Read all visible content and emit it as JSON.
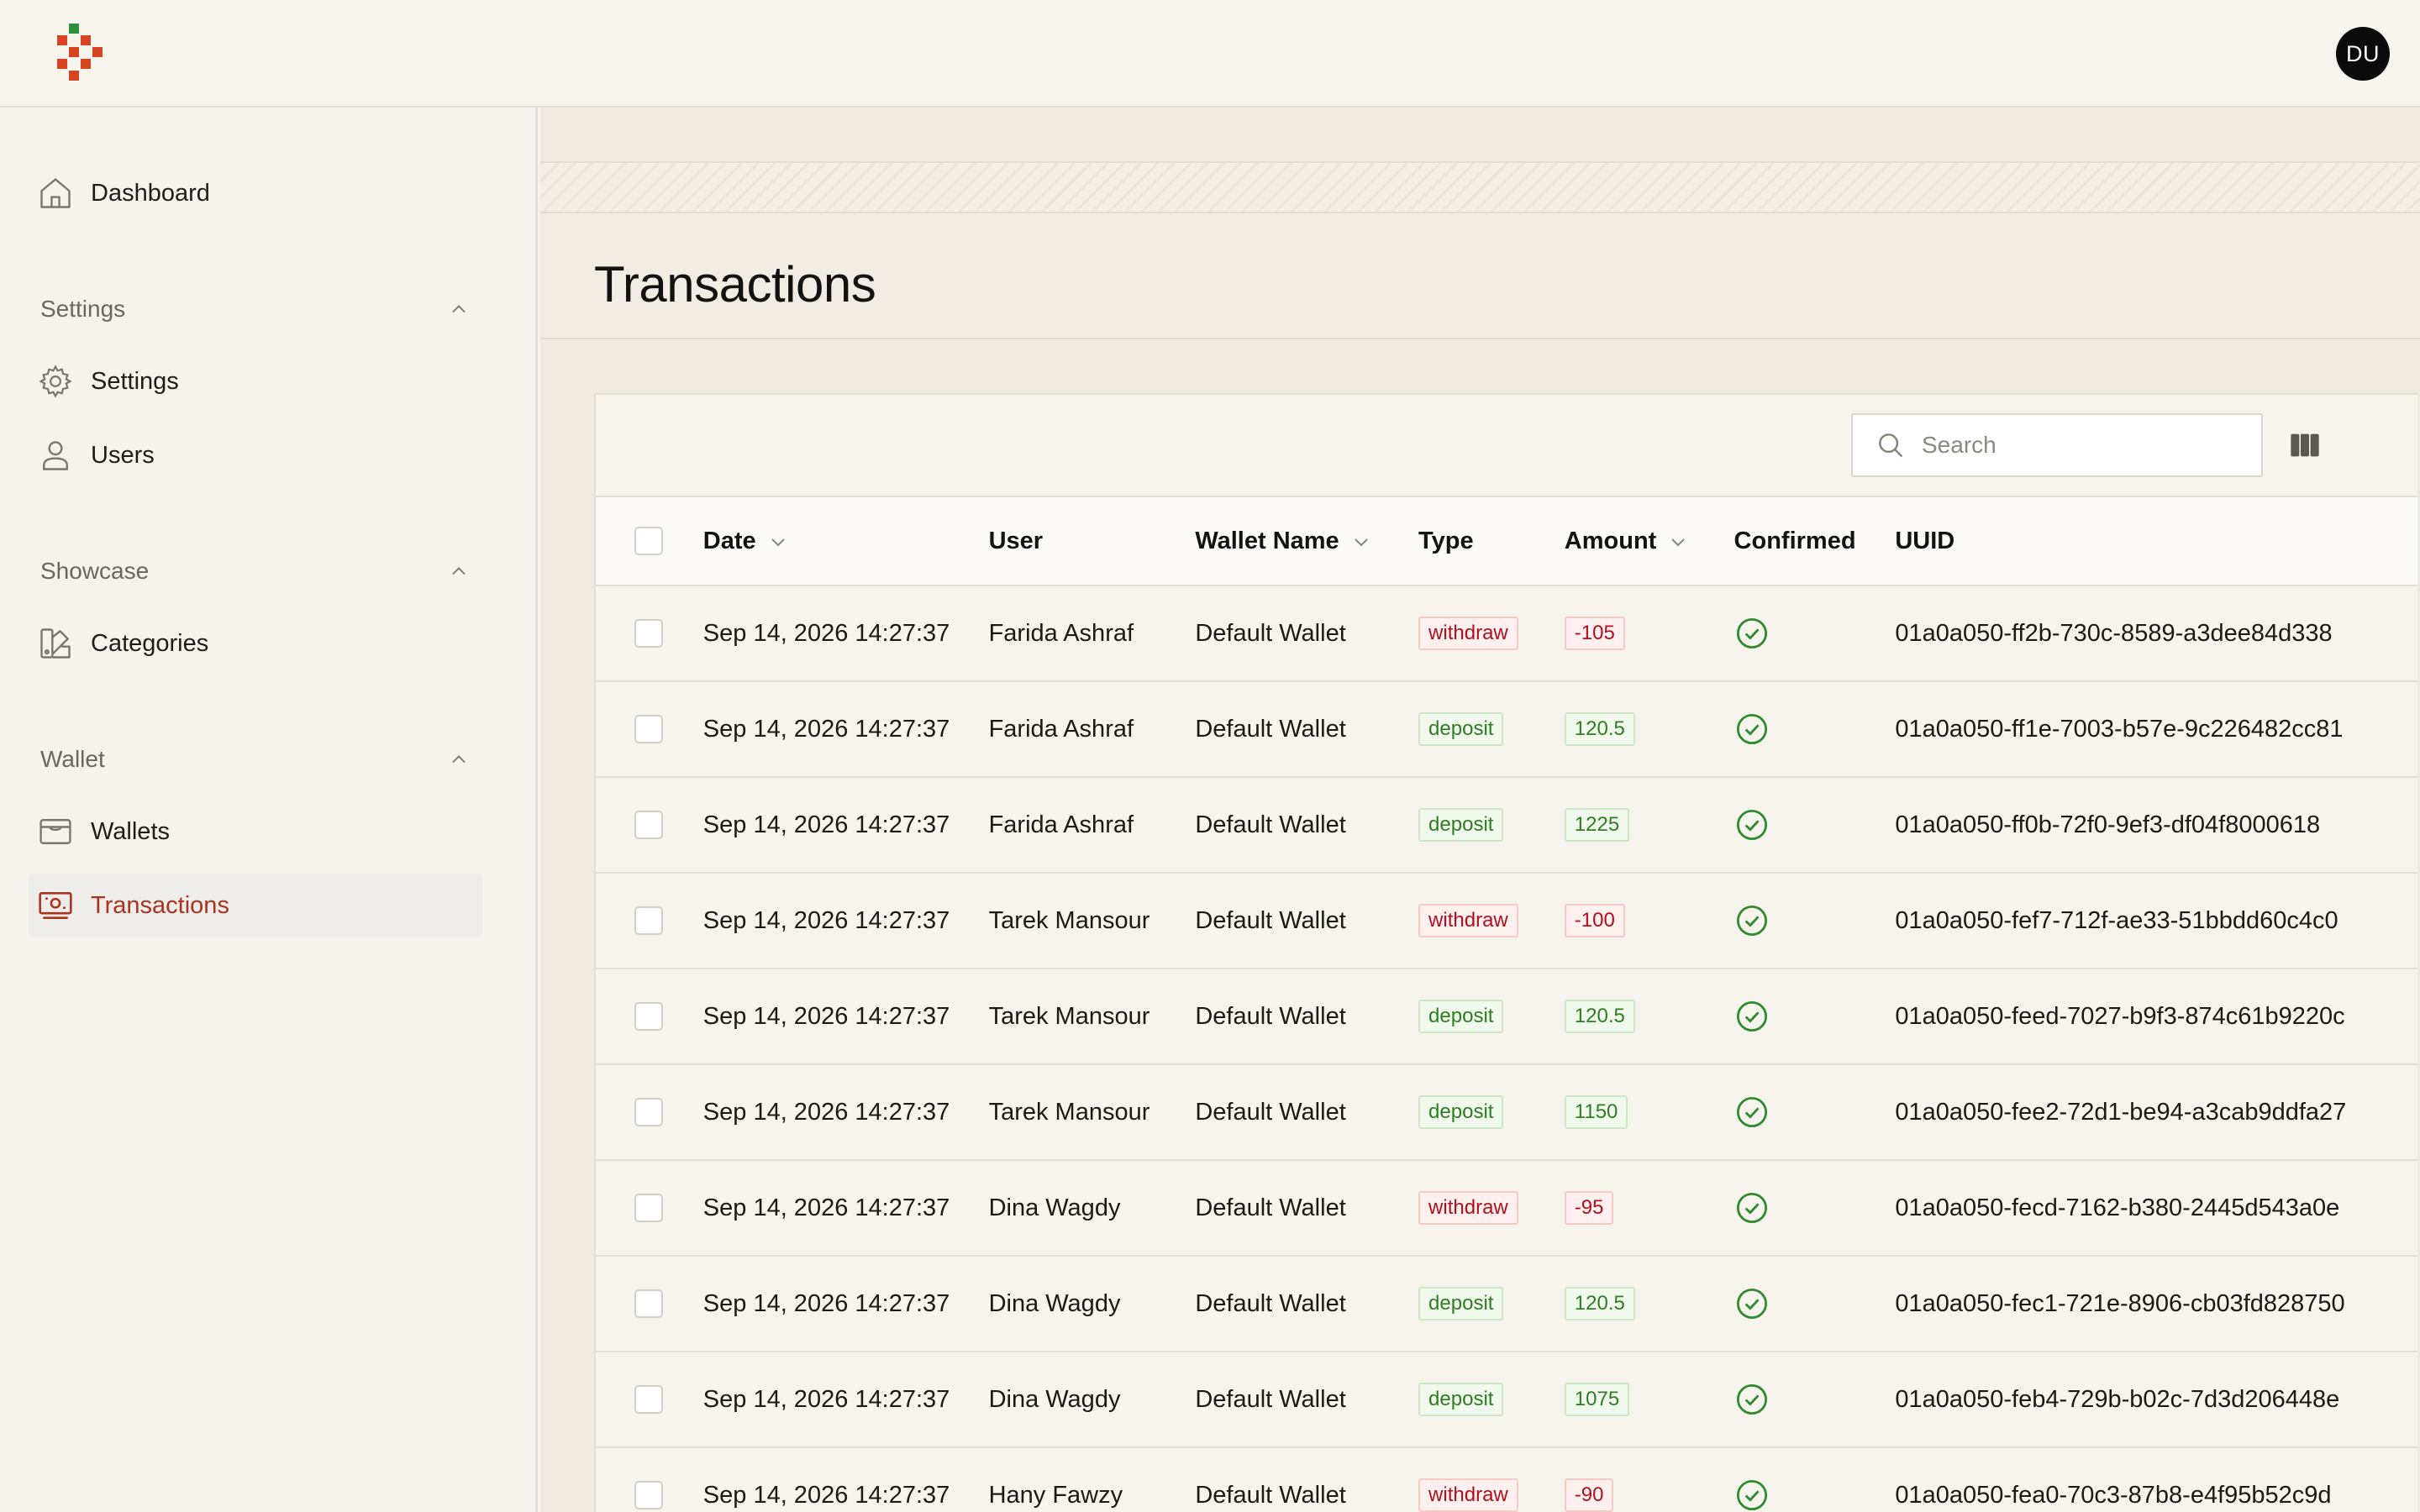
{
  "header": {
    "user_initials": "DU"
  },
  "sidebar": {
    "dashboard_label": "Dashboard",
    "sections": [
      {
        "title": "Settings",
        "items": [
          "Settings",
          "Users"
        ]
      },
      {
        "title": "Showcase",
        "items": [
          "Categories"
        ]
      },
      {
        "title": "Wallet",
        "items": [
          "Wallets",
          "Transactions"
        ]
      }
    ],
    "active_item": "Transactions"
  },
  "page": {
    "title": "Transactions"
  },
  "search": {
    "placeholder": "Search"
  },
  "table": {
    "columns": [
      "Date",
      "User",
      "Wallet Name",
      "Type",
      "Amount",
      "Confirmed",
      "UUID"
    ],
    "rows": [
      {
        "date": "Sep 14, 2026 14:27:37",
        "user": "Farida Ashraf",
        "wallet": "Default Wallet",
        "type": "withdraw",
        "amount": "-105",
        "uuid": "01a0a050-ff2b-730c-8589-a3dee84d338"
      },
      {
        "date": "Sep 14, 2026 14:27:37",
        "user": "Farida Ashraf",
        "wallet": "Default Wallet",
        "type": "deposit",
        "amount": "120.5",
        "uuid": "01a0a050-ff1e-7003-b57e-9c226482cc81"
      },
      {
        "date": "Sep 14, 2026 14:27:37",
        "user": "Farida Ashraf",
        "wallet": "Default Wallet",
        "type": "deposit",
        "amount": "1225",
        "uuid": "01a0a050-ff0b-72f0-9ef3-df04f8000618"
      },
      {
        "date": "Sep 14, 2026 14:27:37",
        "user": "Tarek Mansour",
        "wallet": "Default Wallet",
        "type": "withdraw",
        "amount": "-100",
        "uuid": "01a0a050-fef7-712f-ae33-51bbdd60c4c0"
      },
      {
        "date": "Sep 14, 2026 14:27:37",
        "user": "Tarek Mansour",
        "wallet": "Default Wallet",
        "type": "deposit",
        "amount": "120.5",
        "uuid": "01a0a050-feed-7027-b9f3-874c61b9220c"
      },
      {
        "date": "Sep 14, 2026 14:27:37",
        "user": "Tarek Mansour",
        "wallet": "Default Wallet",
        "type": "deposit",
        "amount": "1150",
        "uuid": "01a0a050-fee2-72d1-be94-a3cab9ddfa27"
      },
      {
        "date": "Sep 14, 2026 14:27:37",
        "user": "Dina Wagdy",
        "wallet": "Default Wallet",
        "type": "withdraw",
        "amount": "-95",
        "uuid": "01a0a050-fecd-7162-b380-2445d543a0e"
      },
      {
        "date": "Sep 14, 2026 14:27:37",
        "user": "Dina Wagdy",
        "wallet": "Default Wallet",
        "type": "deposit",
        "amount": "120.5",
        "uuid": "01a0a050-fec1-721e-8906-cb03fd828750"
      },
      {
        "date": "Sep 14, 2026 14:27:37",
        "user": "Dina Wagdy",
        "wallet": "Default Wallet",
        "type": "deposit",
        "amount": "1075",
        "uuid": "01a0a050-feb4-729b-b02c-7d3d206448e"
      },
      {
        "date": "Sep 14, 2026 14:27:37",
        "user": "Hany Fawzy",
        "wallet": "Default Wallet",
        "type": "withdraw",
        "amount": "-90",
        "uuid": "01a0a050-fea0-70c3-87b8-e4f95b52c9d"
      }
    ]
  },
  "colors": {
    "accent": "#a8341f",
    "withdraw": "#b1101e",
    "deposit": "#2f7d24",
    "confirmed": "#2e8b2e"
  }
}
